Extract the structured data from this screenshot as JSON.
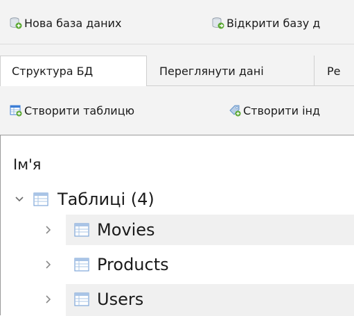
{
  "toolbar": {
    "new_db": "Нова база даних",
    "open_db": "Відкрити базу д"
  },
  "tabs": [
    {
      "label": "Структура БД",
      "active": true
    },
    {
      "label": "Переглянути дані",
      "active": false
    },
    {
      "label": "Ре",
      "active": false
    }
  ],
  "subtoolbar": {
    "create_table": "Створити таблицю",
    "create_index": "Створити інд"
  },
  "tree": {
    "column_header": "Ім'я",
    "root": {
      "label": "Таблиці (4)",
      "expanded": true
    },
    "items": [
      {
        "label": "Movies",
        "expanded": false
      },
      {
        "label": "Products",
        "expanded": false
      },
      {
        "label": "Users",
        "expanded": false
      }
    ]
  },
  "colors": {
    "icon_green": "#5aa832",
    "icon_blue": "#3c7ed6",
    "table_icon": "#7fa7d8"
  }
}
